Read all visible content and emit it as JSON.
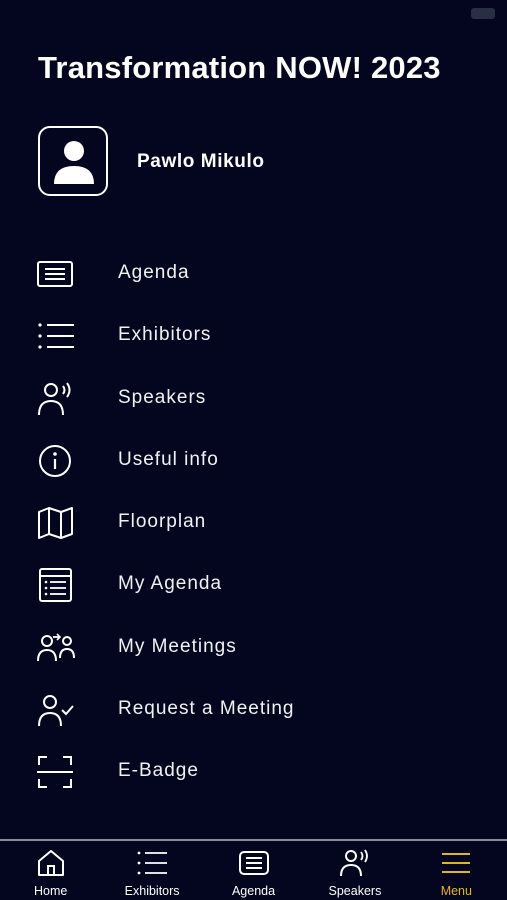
{
  "app": {
    "title": "Transformation NOW! 2023",
    "accent_color": "#e3b51d",
    "background_color": "#03061e"
  },
  "profile": {
    "name": "Pawlo Mikulo",
    "avatar_icon": "person-icon"
  },
  "menu": {
    "items": [
      {
        "label": "Agenda",
        "icon": "agenda-icon"
      },
      {
        "label": "Exhibitors",
        "icon": "list-icon"
      },
      {
        "label": "Speakers",
        "icon": "speaker-icon"
      },
      {
        "label": "Useful info",
        "icon": "info-icon"
      },
      {
        "label": "Floorplan",
        "icon": "map-icon"
      },
      {
        "label": "My Agenda",
        "icon": "my-agenda-icon"
      },
      {
        "label": "My Meetings",
        "icon": "meetings-icon"
      },
      {
        "label": "Request a Meeting",
        "icon": "request-meeting-icon"
      },
      {
        "label": "E-Badge",
        "icon": "scan-icon"
      }
    ]
  },
  "tabbar": {
    "tabs": [
      {
        "label": "Home",
        "icon": "home-icon",
        "active": false
      },
      {
        "label": "Exhibitors",
        "icon": "list-icon",
        "active": false
      },
      {
        "label": "Agenda",
        "icon": "agenda-icon",
        "active": false
      },
      {
        "label": "Speakers",
        "icon": "speaker-icon",
        "active": false
      },
      {
        "label": "Menu",
        "icon": "menu-icon",
        "active": true
      }
    ]
  }
}
